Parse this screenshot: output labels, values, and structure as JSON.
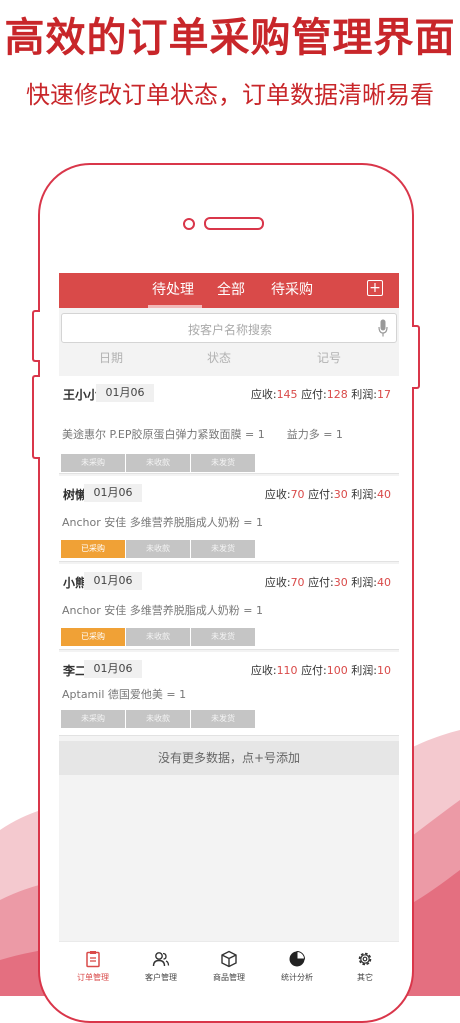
{
  "promo": {
    "title": "高效的订单采购管理界面",
    "subtitle": "快速修改订单状态，订单数据清晰易看"
  },
  "colors": {
    "accent": "#d94a49",
    "promo_red": "#c8262a",
    "orange": "#f0a136",
    "gray_button": "#c5c5c5"
  },
  "header": {
    "tabs": [
      {
        "label": "待处理",
        "active": true
      },
      {
        "label": "全部",
        "active": false
      },
      {
        "label": "待采购",
        "active": false
      }
    ],
    "add_icon": "plus-square-icon"
  },
  "search": {
    "placeholder": "按客户名称搜索",
    "icon": "microphone-icon"
  },
  "sort_bar": [
    "日期",
    "状态",
    "记号"
  ],
  "orders": [
    {
      "name": "王小小",
      "date": "01月06",
      "receivable_label": "应收:",
      "receivable": "145",
      "payable_label": "应付:",
      "payable": "128",
      "profit_label": "利润:",
      "profit": "17",
      "products": "美途惠尔 P.EP胶原蛋白弹力紧致面膜 = 1　　益力多 = 1",
      "statuses": [
        "未采购",
        "未收款",
        "未发货"
      ],
      "purchased": false
    },
    {
      "name": "树懒",
      "date": "01月06",
      "receivable_label": "应收:",
      "receivable": "70",
      "payable_label": "应付:",
      "payable": "30",
      "profit_label": "利润:",
      "profit": "40",
      "products": "Anchor 安佳 多维营养脱脂成人奶粉 = 1",
      "statuses": [
        "已采购",
        "未收款",
        "未发货"
      ],
      "purchased": true
    },
    {
      "name": "小熊",
      "date": "01月06",
      "receivable_label": "应收:",
      "receivable": "70",
      "payable_label": "应付:",
      "payable": "30",
      "profit_label": "利润:",
      "profit": "40",
      "products": "Anchor 安佳 多维营养脱脂成人奶粉 = 1",
      "statuses": [
        "已采购",
        "未收款",
        "未发货"
      ],
      "purchased": true
    },
    {
      "name": "李二",
      "date": "01月06",
      "receivable_label": "应收:",
      "receivable": "110",
      "payable_label": "应付:",
      "payable": "100",
      "profit_label": "利润:",
      "profit": "10",
      "products": "Aptamil 德国爱他美 = 1",
      "statuses": [
        "未采购",
        "未收款",
        "未发货"
      ],
      "purchased": false
    }
  ],
  "no_more": "没有更多数据，点+号添加",
  "bottom_nav": [
    {
      "label": "订单管理",
      "icon": "clipboard-icon",
      "active": true
    },
    {
      "label": "客户管理",
      "icon": "users-icon",
      "active": false
    },
    {
      "label": "商品管理",
      "icon": "box-icon",
      "active": false
    },
    {
      "label": "统计分析",
      "icon": "pie-chart-icon",
      "active": false
    },
    {
      "label": "其它",
      "icon": "gear-icon",
      "active": false
    }
  ]
}
